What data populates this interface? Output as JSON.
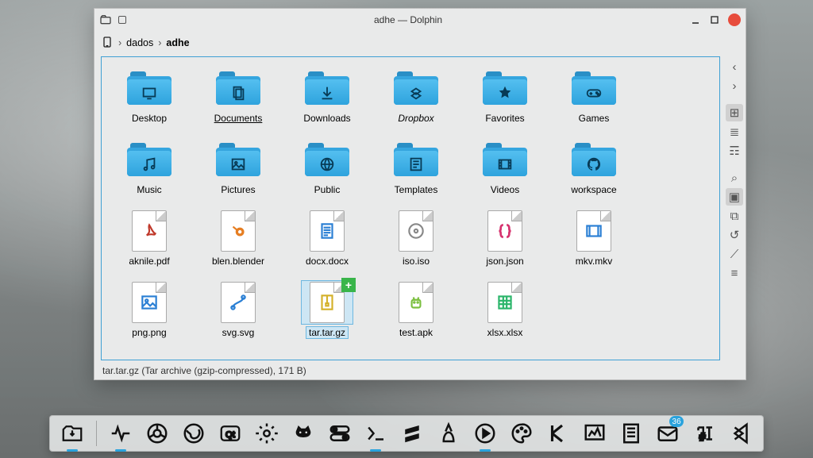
{
  "window": {
    "title": "adhe — Dolphin",
    "breadcrumbs": {
      "root_icon": "phone-icon",
      "item1": "dados",
      "current": "adhe"
    },
    "status": "tar.tar.gz (Tar archive (gzip-compressed), 171 B)"
  },
  "items": [
    {
      "name": "Desktop",
      "kind": "folder",
      "glyph": "desktop",
      "label": "Desktop"
    },
    {
      "name": "Documents",
      "kind": "folder",
      "glyph": "documents",
      "label": "Documents",
      "underline": true
    },
    {
      "name": "Downloads",
      "kind": "folder",
      "glyph": "download",
      "label": "Downloads"
    },
    {
      "name": "Dropbox",
      "kind": "folder",
      "glyph": "dropbox",
      "label": "Dropbox",
      "italic": true
    },
    {
      "name": "Favorites",
      "kind": "folder",
      "glyph": "star",
      "label": "Favorites"
    },
    {
      "name": "Games",
      "kind": "folder",
      "glyph": "gamepad",
      "label": "Games"
    },
    {
      "name": "Music",
      "kind": "folder",
      "glyph": "music",
      "label": "Music"
    },
    {
      "name": "Pictures",
      "kind": "folder",
      "glyph": "picture",
      "label": "Pictures"
    },
    {
      "name": "Public",
      "kind": "folder",
      "glyph": "public",
      "label": "Public"
    },
    {
      "name": "Templates",
      "kind": "folder",
      "glyph": "template",
      "label": "Templates"
    },
    {
      "name": "Videos",
      "kind": "folder",
      "glyph": "video",
      "label": "Videos"
    },
    {
      "name": "workspace",
      "kind": "folder",
      "glyph": "github",
      "label": "workspace"
    },
    {
      "name": "aknile.pdf",
      "kind": "file",
      "glyph_color": "#c0392b",
      "glyph": "pdf",
      "label": "aknile.pdf"
    },
    {
      "name": "blen.blender",
      "kind": "file",
      "glyph_color": "#e67e22",
      "glyph": "blender",
      "label": "blen.blender"
    },
    {
      "name": "docx.docx",
      "kind": "file",
      "glyph_color": "#2a7fd4",
      "glyph": "doc",
      "label": "docx.docx"
    },
    {
      "name": "iso.iso",
      "kind": "file",
      "glyph_color": "#888",
      "glyph": "iso",
      "label": "iso.iso"
    },
    {
      "name": "json.json",
      "kind": "file",
      "glyph_color": "#d6326e",
      "glyph": "json",
      "label": "json.json"
    },
    {
      "name": "mkv.mkv",
      "kind": "file",
      "glyph_color": "#2a7fd4",
      "glyph": "video",
      "label": "mkv.mkv"
    },
    {
      "name": "png.png",
      "kind": "file",
      "glyph_color": "#2a7fd4",
      "glyph": "image",
      "label": "png.png"
    },
    {
      "name": "svg.svg",
      "kind": "file",
      "glyph_color": "#2a7fd4",
      "glyph": "svg",
      "label": "svg.svg"
    },
    {
      "name": "tar.tar.gz",
      "kind": "file",
      "glyph_color": "#d4b12a",
      "glyph": "archive",
      "label": "tar.tar.gz",
      "selected": true,
      "emblem": "+"
    },
    {
      "name": "test.apk",
      "kind": "file",
      "glyph_color": "#7bbf3f",
      "glyph": "android",
      "label": "test.apk"
    },
    {
      "name": "xlsx.xlsx",
      "kind": "file",
      "glyph_color": "#2bb56a",
      "glyph": "sheet",
      "label": "xlsx.xlsx"
    }
  ],
  "side_tools": [
    {
      "name": "back",
      "icon": "‹"
    },
    {
      "name": "forward",
      "icon": "›"
    },
    {
      "sep": true
    },
    {
      "name": "icon-view",
      "icon": "⊞",
      "active": true
    },
    {
      "name": "compact-view",
      "icon": "≣"
    },
    {
      "name": "details-view",
      "icon": "☶"
    },
    {
      "sep": true
    },
    {
      "name": "search",
      "icon": "⌕"
    },
    {
      "name": "preview",
      "icon": "▣",
      "active": true
    },
    {
      "name": "split",
      "icon": "⧉"
    },
    {
      "name": "history",
      "icon": "↺"
    },
    {
      "name": "hidden",
      "icon": "⟋"
    },
    {
      "name": "menu",
      "icon": "≡"
    }
  ],
  "dock": {
    "items": [
      {
        "name": "files",
        "running": true
      },
      {
        "name": "pulse",
        "running": true
      },
      {
        "name": "chrome",
        "running": false
      },
      {
        "name": "firefox",
        "running": false
      },
      {
        "name": "qt",
        "running": false
      },
      {
        "name": "gear",
        "running": false
      },
      {
        "name": "cat",
        "running": false
      },
      {
        "name": "toggle",
        "running": false
      },
      {
        "name": "terminal",
        "running": true
      },
      {
        "name": "sublime",
        "running": false
      },
      {
        "name": "tux",
        "running": false
      },
      {
        "name": "play",
        "running": true
      },
      {
        "name": "palette",
        "running": false
      },
      {
        "name": "kate",
        "running": false
      },
      {
        "name": "monitor",
        "running": false
      },
      {
        "name": "notes",
        "running": false
      },
      {
        "name": "mail",
        "running": false,
        "badge": "36"
      },
      {
        "name": "typografy",
        "running": false
      },
      {
        "name": "vscode",
        "running": false
      }
    ]
  }
}
